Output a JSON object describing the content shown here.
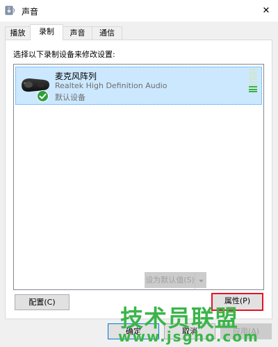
{
  "window": {
    "title": "声音",
    "icon": "speaker-icon",
    "close_glyph": "✕"
  },
  "tabs": [
    {
      "label": "播放",
      "active": false
    },
    {
      "label": "录制",
      "active": true
    },
    {
      "label": "声音",
      "active": false
    },
    {
      "label": "通信",
      "active": false
    }
  ],
  "panel": {
    "instruction": "选择以下录制设备来修改设置:",
    "devices": [
      {
        "name": "麦克风阵列",
        "driver": "Realtek High Definition Audio",
        "status": "默认设备",
        "icon": "microphone-array-icon",
        "badge": "default-checkmark-icon",
        "selected": true,
        "level_segments": 10,
        "level_active": 3
      }
    ]
  },
  "buttons": {
    "configure": "配置(C)",
    "set_default": "设为默认值(S)",
    "properties": "属性(P)",
    "ok": "确定",
    "cancel": "取消",
    "apply": "应用(A)"
  },
  "watermark": {
    "brand": "技术员联盟",
    "url": "www.jsgho.com"
  },
  "colors": {
    "selection_bg": "#cce8ff",
    "selection_border": "#3399ff",
    "level_active": "#3fb13f",
    "level_inactive": "#cfe6cf",
    "highlight_border": "#e81123",
    "watermark": "#3ab54a"
  }
}
